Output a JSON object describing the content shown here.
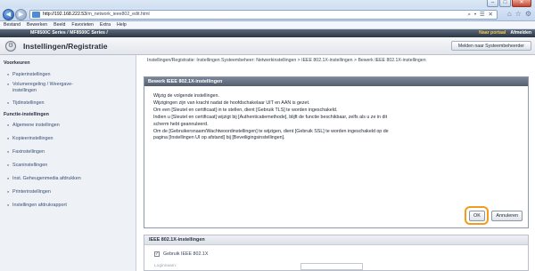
{
  "browser": {
    "window_buttons": [
      "–",
      "□",
      "✕"
    ],
    "url_host": "http://192.168.222.53",
    "url_path": "/m_network_ieee802_edit.html",
    "address_tools": "⌕ • ☰ ✕",
    "home_icon": "⌂",
    "star_icon": "☆",
    "gear_icon": "⚙",
    "menu": [
      "Bestand",
      "Bewerken",
      "Beeld",
      "Favorieten",
      "Extra",
      "Help"
    ]
  },
  "device": {
    "model_prefix": "MF8500C Series / MF8500C Series /",
    "portal_link": "Naar portaal",
    "logout_link": "Afmelden"
  },
  "header": {
    "title": "Instellingen/Registratie",
    "to_sysadmin": "Melden naar Systeembeheerder"
  },
  "sidebar": {
    "sections": [
      {
        "title": "Voorkeuren",
        "items": [
          "Papierinstellingen",
          "Volumeregeling / Weergave-instellingen",
          "Tijdinstellingen"
        ]
      },
      {
        "title": "Functie-instellingen",
        "items": [
          "Algemene instellingen",
          "Kopieerinstellingen",
          "Faxinstellingen",
          "Scaninstellingen",
          "Inst. Geheugenmedia afdrukken",
          "Printerinstellingen",
          "Instellingen afdrukrapport"
        ]
      }
    ]
  },
  "breadcrumb": "Instellingen/Registratie: Instellingen Systeembeheer: Netwerkinstellingen > IEEE 802.1X-instellingen > Bewerk IEEE 802.1X-instellingen",
  "dialog": {
    "title": "Bewerk IEEE 802.1X-instellingen",
    "lines": [
      "Wijzig de volgende instellingen.",
      "Wijzigingen zijn van kracht nadat de hoofdschakelaar UIT en AAN is gezet.",
      "Om een [Sleutel en certificaat] in te stellen, dient [Gebruik TLS] te worden ingeschakeld.",
      "Indien u [Sleutel en certificaat] wijzigt bij [Authenticatiemethode], blijft de functie beschikbaar, zelfs als u ze in dit",
      "scherm hebt geannuleerd.",
      "Om de [Gebruikersnaam/Wachtwoordinstellingen] te wijzigen, dient [Gebruik SSL] te worden ingeschakeld op de",
      "pagina [Instellingen UI op afstand] bij [Beveiligingsinstellingen]."
    ],
    "ok_label": "OK",
    "cancel_label": "Annuleren"
  },
  "lower_panel": {
    "title": "IEEE 802.1X-instellingen",
    "checkbox_label": "Gebruik IEEE 802.1X",
    "checkbox_checked": true,
    "sub_label": "Loginnaam:"
  }
}
